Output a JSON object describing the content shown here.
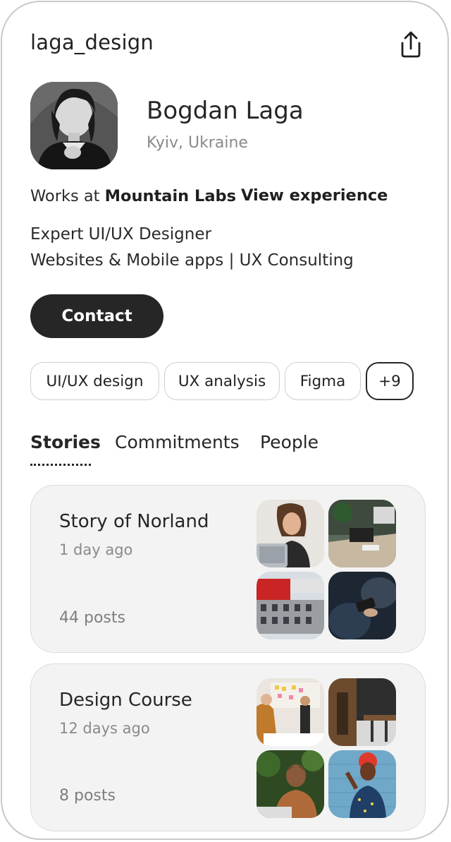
{
  "header": {
    "username": "laga_design",
    "share_icon": "share-upload-icon"
  },
  "profile": {
    "name": "Bogdan Laga",
    "location": "Kyiv, Ukraine",
    "works_prefix": "Works at",
    "company": "Mountain Labs",
    "view_experience": "View experience",
    "bio_line1": "Expert UI/UX Designer",
    "bio_line2": "Websites & Mobile apps | UX Consulting",
    "contact_label": "Contact"
  },
  "tags": [
    "UI/UX design",
    "UX analysis",
    "Figma",
    "+9"
  ],
  "tabs": [
    "Stories",
    "Commitments",
    "People"
  ],
  "active_tab": "Stories",
  "stories": [
    {
      "title": "Story of Norland",
      "time": "1 day ago",
      "posts": "44 posts"
    },
    {
      "title": "Design Course",
      "time": "12 days ago",
      "posts": "8 posts"
    }
  ],
  "colors": {
    "dark_button": "#262626",
    "card_bg": "#f3f3f3",
    "muted_text": "#8a8a8a"
  }
}
